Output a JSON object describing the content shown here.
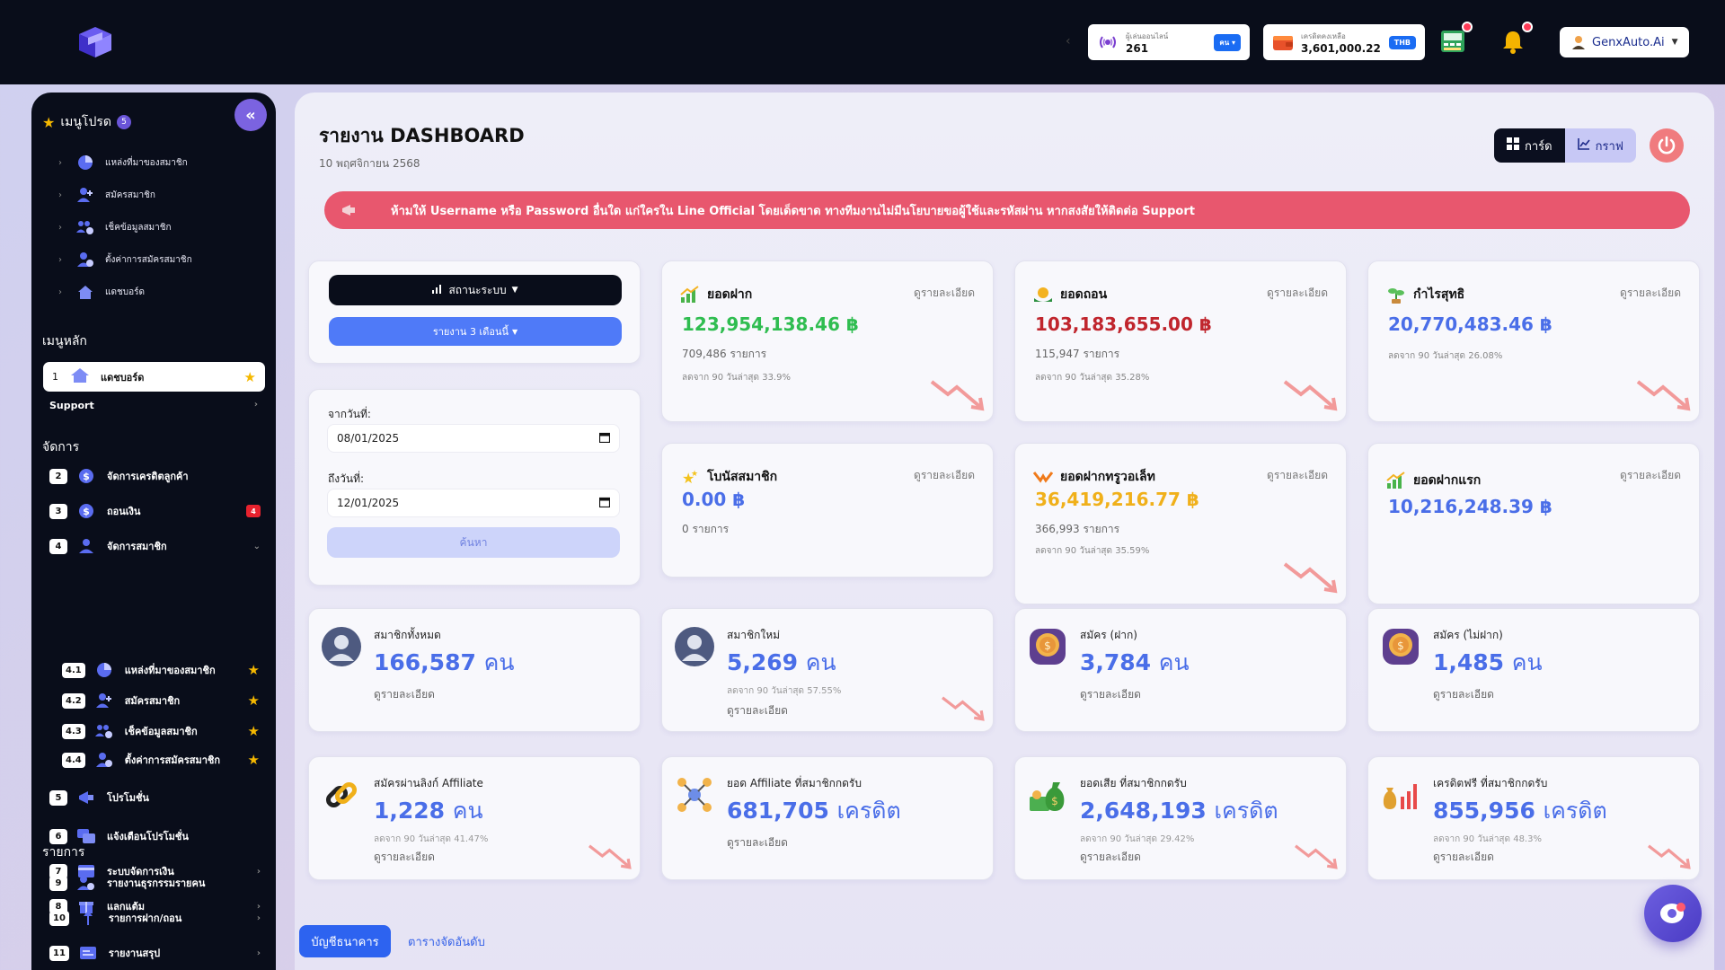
{
  "colors": {
    "accent_blue": "#4a6ee8",
    "green": "#2fbd50",
    "red": "#c0252d",
    "orange": "#f0b01a",
    "alert": "#e8576e",
    "sidebar_bg": "#090d1a"
  },
  "topbar": {
    "online": {
      "label": "ผู้เล่นออนไลน์",
      "value": "261",
      "unit": "คน"
    },
    "credit": {
      "label": "เครดิตคงเหลือ",
      "value": "3,601,000.22",
      "unit": "THB"
    },
    "user_name": "GenxAuto.Ai",
    "icons": [
      "logo-icon",
      "broadcast-icon",
      "wallet-icon",
      "cashier-icon",
      "bell-icon",
      "user-icon"
    ]
  },
  "sidebar": {
    "favorites_title": "เมนูโปรด",
    "favorites_count": "5",
    "favorites": [
      {
        "label": "แหล่งที่มาของสมาชิก",
        "icon": "pie-chart-icon"
      },
      {
        "label": "สมัครสมาชิก",
        "icon": "user-plus-icon"
      },
      {
        "label": "เช็คข้อมูลสมาชิก",
        "icon": "users-gear-icon"
      },
      {
        "label": "ตั้งค่าการสมัครสมาชิก",
        "icon": "user-gear-icon"
      },
      {
        "label": "แดชบอร์ด",
        "icon": "home-icon"
      }
    ],
    "main_menu_title": "เมนูหลัก",
    "dashboard": {
      "num": "1",
      "label": "แดชบอร์ด"
    },
    "support_label": "Support",
    "manage_title": "จัดการ",
    "manage_items": [
      {
        "num": "2",
        "label": "จัดการเครดิตลูกค้า"
      },
      {
        "num": "3",
        "label": "ถอนเงิน",
        "badge": "4"
      },
      {
        "num": "4",
        "label": "จัดการสมาชิก"
      },
      {
        "num": "4.1",
        "label": "แหล่งที่มาของสมาชิก"
      },
      {
        "num": "4.2",
        "label": "สมัครสมาชิก"
      },
      {
        "num": "4.3",
        "label": "เช็คข้อมูลสมาชิก"
      },
      {
        "num": "4.4",
        "label": "ตั้งค่าการสมัครสมาชิก"
      },
      {
        "num": "5",
        "label": "โปรโมชั่น"
      },
      {
        "num": "6",
        "label": "แจ้งเตือนโปรโมชั่น"
      },
      {
        "num": "7",
        "label": "ระบบจัดการเงิน"
      },
      {
        "num": "8",
        "label": "แลกแต้ม"
      }
    ],
    "report_title": "รายการ",
    "report_items": [
      {
        "num": "9",
        "label": "รายงานธุรกรรมรายคน"
      },
      {
        "num": "10",
        "label": "รายการฝาก/ถอน"
      },
      {
        "num": "11",
        "label": "รายงานสรุป"
      }
    ]
  },
  "header": {
    "title": "รายงาน DASHBOARD",
    "date": "10 พฤศจิกายน 2568",
    "view_card": "การ์ด",
    "view_graph": "กราฟ"
  },
  "alert": "ห้ามให้ Username หรือ Password อื่นใด แก่ใครใน Line Official โดยเด็ดขาด ทางทีมงานไม่มีนโยบายขอผู้ใช้และรหัสผ่าน หากสงสัยให้ติดต่อ Support",
  "filters": {
    "status_button": "สถานะระบบ",
    "report_button": "รายงาน 3 เดือนนี้",
    "from_label": "จากวันที่:",
    "from_value": "08/01/2025",
    "to_label": "ถึงวันที่:",
    "to_value": "12/01/2025",
    "search_button": "ค้นหา"
  },
  "stats": [
    {
      "title": "ยอดฝาก",
      "value": "123,954,138.46 ฿",
      "count": "709,486 รายการ",
      "pct": "ลดจาก 90 วันล่าสุด 33.9%",
      "link": "ดูรายละเอียด",
      "icon": "chart-up-icon"
    },
    {
      "title": "ยอดถอน",
      "value": "103,183,655.00 ฿",
      "count": "115,947 รายการ",
      "pct": "ลดจาก 90 วันล่าสุด 35.28%",
      "link": "ดูรายละเอียด",
      "icon": "coin-hand-icon"
    },
    {
      "title": "กำไรสุทธิ",
      "value": "20,770,483.46 ฿",
      "pct": "ลดจาก 90 วันล่าสุด 26.08%",
      "link": "ดูรายละเอียด",
      "icon": "money-plant-icon"
    },
    {
      "title": "โบนัสสมาชิก",
      "value": "0.00 ฿",
      "count": "0 รายการ",
      "link": "ดูรายละเอียด",
      "icon": "stars-icon"
    },
    {
      "title": "ยอดฝากทรูวอเล็ท",
      "value": "36,419,216.77 ฿",
      "count": "366,993 รายการ",
      "pct": "ลดจาก 90 วันล่าสุด 35.59%",
      "link": "ดูรายละเอียด",
      "icon": "truewallet-icon"
    },
    {
      "title": "ยอดฝากแรก",
      "value": "10,216,248.39 ฿",
      "link": "ดูรายละเอียด",
      "icon": "chart-up-icon"
    }
  ],
  "members": [
    {
      "label": "สมาชิกทั้งหมด",
      "value": "166,587",
      "unit": "คน",
      "link": "ดูรายละเอียด"
    },
    {
      "label": "สมาชิกใหม่",
      "value": "5,269",
      "unit": "คน",
      "pct": "ลดจาก 90 วันล่าสุด 57.55%",
      "link": "ดูรายละเอียด"
    },
    {
      "label": "สมัคร (ฝาก)",
      "value": "3,784",
      "unit": "คน",
      "link": "ดูรายละเอียด"
    },
    {
      "label": "สมัคร (ไม่ฝาก)",
      "value": "1,485",
      "unit": "คน",
      "link": "ดูรายละเอียด"
    },
    {
      "label": "สมัครผ่านลิงก์ Affiliate",
      "value": "1,228",
      "unit": "คน",
      "pct": "ลดจาก 90 วันล่าสุด 41.47%",
      "link": "ดูรายละเอียด"
    },
    {
      "label": "ยอด Affiliate ที่สมาชิกกดรับ",
      "value": "681,705",
      "unit": "เครดิต",
      "link": "ดูรายละเอียด"
    },
    {
      "label": "ยอดเสีย ที่สมาชิกกดรับ",
      "value": "2,648,193",
      "unit": "เครดิต",
      "pct": "ลดจาก 90 วันล่าสุด 29.42%",
      "link": "ดูรายละเอียด"
    },
    {
      "label": "เครดิตฟรี ที่สมาชิกกดรับ",
      "value": "855,956",
      "unit": "เครดิต",
      "pct": "ลดจาก 90 วันล่าสุด 48.3%",
      "link": "ดูรายละเอียด"
    }
  ],
  "tabs": {
    "bank": "บัญชีธนาคาร",
    "ranking": "ตารางจัดอันดับ"
  }
}
